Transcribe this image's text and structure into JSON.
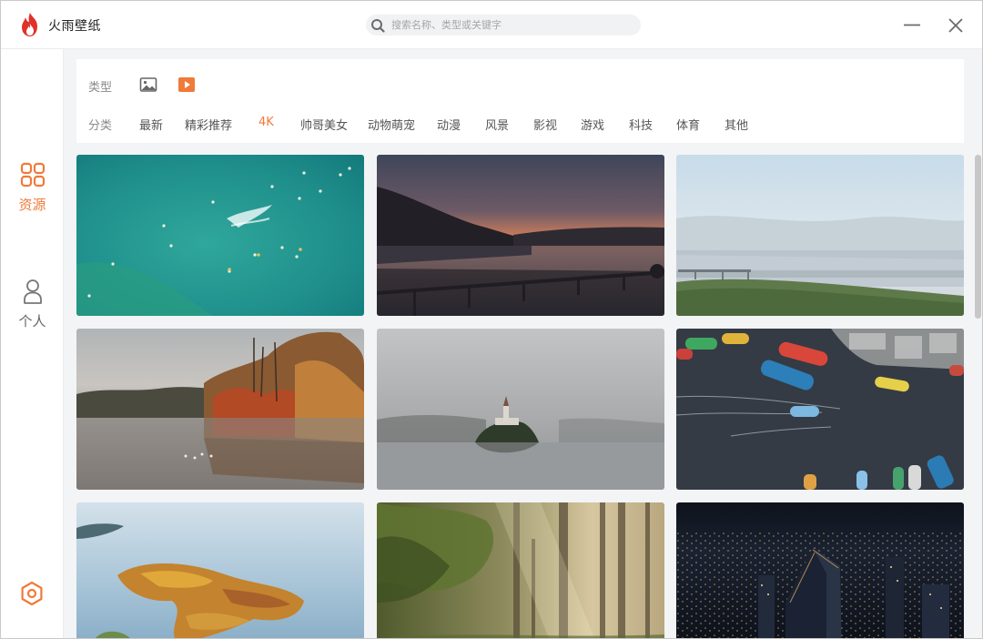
{
  "app": {
    "title": "火雨壁纸"
  },
  "search": {
    "placeholder": "搜索名称、类型或关键字"
  },
  "sidebar": {
    "items": [
      {
        "label": "资源",
        "icon": "grid-icon",
        "active": true
      },
      {
        "label": "个人",
        "icon": "person-icon",
        "active": false
      }
    ],
    "settings_icon": "settings-icon"
  },
  "filters": {
    "type_label": "类型",
    "type_options": [
      {
        "icon": "image-icon",
        "active": false
      },
      {
        "icon": "video-icon",
        "active": true
      }
    ],
    "category_label": "分类",
    "categories": [
      "最新",
      "精彩推荐",
      "4K",
      "帅哥美女",
      "动物萌宠",
      "动漫",
      "风景",
      "影视",
      "游戏",
      "科技",
      "体育",
      "其他"
    ],
    "active_category": "4K"
  },
  "wallpapers": [
    {
      "subject": "aerial turquoise sea with surfers"
    },
    {
      "subject": "lake bridge at sunset dusk"
    },
    {
      "subject": "misty lake with pier and green meadow"
    },
    {
      "subject": "autumn trees reflected in calm lake"
    },
    {
      "subject": "foggy lake island with church"
    },
    {
      "subject": "aerial harbor with colorful boats"
    },
    {
      "subject": "aerial lake with autumn forest peninsula"
    },
    {
      "subject": "sunlit misty forest"
    },
    {
      "subject": "night city skyline aerial"
    }
  ],
  "colors": {
    "accent": "#f07a3a",
    "brand_red": "#e0322a"
  }
}
